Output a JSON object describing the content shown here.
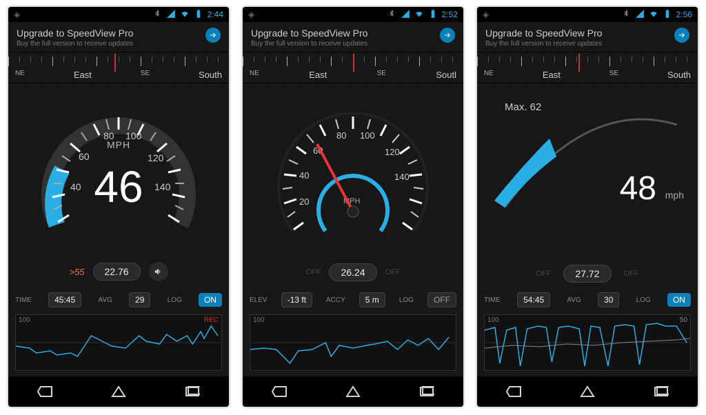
{
  "screens": [
    {
      "status": {
        "time": "2:44"
      },
      "banner": {
        "title": "Upgrade to SpeedView Pro",
        "sub": "Buy the full version to receive updates"
      },
      "compass": {
        "l1": "NE",
        "l2": "East",
        "l3": "SE",
        "l4": "South"
      },
      "gauge": {
        "unit": "MPH",
        "speed": "46",
        "ticks": [
          "40",
          "60",
          "80",
          "100",
          "120",
          "140"
        ],
        "overspeed": ">55",
        "pill": "22.76"
      },
      "stats": {
        "k1": "TIME",
        "v1": "45:45",
        "k2": "AVG",
        "v2": "29",
        "k3": "LOG",
        "log_on": true,
        "log_label": "ON"
      },
      "graph": {
        "yscale": "100",
        "rec": "REC"
      }
    },
    {
      "status": {
        "time": "2:52"
      },
      "banner": {
        "title": "Upgrade to SpeedView Pro",
        "sub": "Buy the full version to receive updates"
      },
      "compass": {
        "l1": "NE",
        "l2": "East",
        "l3": "SE",
        "l4": "Soutl"
      },
      "gauge": {
        "unit": "MPH",
        "speed": "",
        "ticks": [
          "20",
          "40",
          "60",
          "80",
          "100",
          "120",
          "140"
        ],
        "overspeed": "",
        "pill": "26.24"
      },
      "stats": {
        "k1": "ELEV",
        "v1": "-13 ft",
        "k2": "ACCY",
        "v2": "5 m",
        "k3": "LOG",
        "log_on": false,
        "log_label": "OFF"
      },
      "graph": {
        "yscale": "100",
        "rec": ""
      }
    },
    {
      "status": {
        "time": "2:56"
      },
      "banner": {
        "title": "Upgrade to SpeedView Pro",
        "sub": "Buy the full version to receive updates"
      },
      "compass": {
        "l1": "NE",
        "l2": "East",
        "l3": "SE",
        "l4": "South"
      },
      "hud": {
        "max": "Max. 62",
        "speed": "48",
        "unit": "mph",
        "pill": "27.72",
        "off": "OFF"
      },
      "stats": {
        "k1": "TIME",
        "v1": "54:45",
        "k2": "AVG",
        "v2": "30",
        "k3": "LOG",
        "log_on": true,
        "log_label": "ON"
      },
      "graph": {
        "yscale": "100",
        "scale_right": "50"
      }
    }
  ]
}
